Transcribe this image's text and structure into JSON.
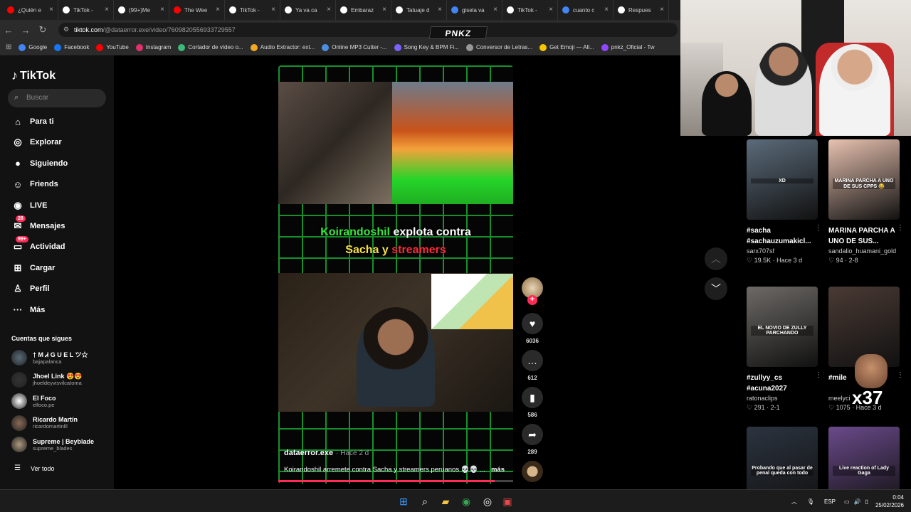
{
  "browser": {
    "tabs": [
      {
        "title": "¿Quién e",
        "icon": "youtube-icon",
        "color": "#ff0000"
      },
      {
        "title": "TikTok -",
        "icon": "tiktok-icon",
        "color": "#ffffff"
      },
      {
        "title": "(99+)Me",
        "icon": "tiktok-icon",
        "color": "#ffffff"
      },
      {
        "title": "The Wee",
        "icon": "youtube-icon",
        "color": "#ff0000"
      },
      {
        "title": "TikTok -",
        "icon": "tiktok-icon",
        "color": "#ffffff"
      },
      {
        "title": "Ya va ca",
        "icon": "tiktok-icon",
        "color": "#ffffff"
      },
      {
        "title": "Embaraz",
        "icon": "tiktok-icon",
        "color": "#ffffff"
      },
      {
        "title": "Tatuaje d",
        "icon": "tiktok-icon",
        "color": "#ffffff"
      },
      {
        "title": "gisela va",
        "icon": "google-icon",
        "color": "#4285f4"
      },
      {
        "title": "TikTok -",
        "icon": "tiktok-icon",
        "color": "#ffffff"
      },
      {
        "title": "cuanto c",
        "icon": "google-icon",
        "color": "#4285f4"
      },
      {
        "title": "Respues",
        "icon": "tiktok-icon",
        "color": "#ffffff"
      }
    ],
    "url_host": "tiktok.com",
    "url_path": "/@dataerror.exe/video/7609820556933729557",
    "overlay_logo": "PNKZ",
    "bookmarks": [
      {
        "label": "Google",
        "color": "#4285f4"
      },
      {
        "label": "Facebook",
        "color": "#1877f2"
      },
      {
        "label": "YouTube",
        "color": "#ff0000"
      },
      {
        "label": "Instagram",
        "color": "#e1306c"
      },
      {
        "label": "Cortador de vídeo o...",
        "color": "#3cb878"
      },
      {
        "label": "Audio Extractor: ext...",
        "color": "#f5a623"
      },
      {
        "label": "Online MP3 Cutter -...",
        "color": "#4a90e2"
      },
      {
        "label": "Song Key & BPM Fi...",
        "color": "#7b61ff"
      },
      {
        "label": "Conversor de Letras...",
        "color": "#999999"
      },
      {
        "label": "Get Emoji — All...",
        "color": "#f7c600"
      },
      {
        "label": "pnkz_Oficial - Tw",
        "color": "#9146ff"
      }
    ]
  },
  "sidebar": {
    "logo": "TikTok",
    "search_placeholder": "Buscar",
    "nav": [
      {
        "label": "Para ti",
        "icon": "home-icon",
        "glyph": "⌂"
      },
      {
        "label": "Explorar",
        "icon": "compass-icon",
        "glyph": "◎"
      },
      {
        "label": "Siguiendo",
        "icon": "following-avatar-icon",
        "glyph": "●"
      },
      {
        "label": "Friends",
        "icon": "friends-icon",
        "glyph": "☺"
      },
      {
        "label": "LIVE",
        "icon": "live-icon",
        "glyph": "◉"
      },
      {
        "label": "Mensajes",
        "icon": "messages-icon",
        "glyph": "✉",
        "badge": "28"
      },
      {
        "label": "Actividad",
        "icon": "activity-icon",
        "glyph": "▭",
        "badge": "99+"
      },
      {
        "label": "Cargar",
        "icon": "upload-icon",
        "glyph": "⊞"
      },
      {
        "label": "Perfil",
        "icon": "profile-icon",
        "glyph": "♙"
      },
      {
        "label": "Más",
        "icon": "more-icon",
        "glyph": "···"
      }
    ],
    "following_title": "Cuentas que sigues",
    "accounts": [
      {
        "name": "† M Ꮧ G U E L ツ☆",
        "handle": "bajapalanca",
        "color": "#5a6b7a"
      },
      {
        "name": "Jhoel Link 😍😍",
        "handle": "jhoeldeyvisvilcatoma",
        "color": "#333333"
      },
      {
        "name": "El Foco",
        "handle": "elfoco.pe",
        "color": "#ffffff"
      },
      {
        "name": "Ricardo Martín",
        "handle": "ricardomartinlll",
        "color": "#8a6a55"
      },
      {
        "name": "Supreme | Beyblade",
        "handle": "supreme_blades",
        "color": "#b09a80"
      }
    ],
    "see_all": "Ver todo"
  },
  "video": {
    "headline_line1_a": "Koirandoshil",
    "headline_line1_b": "explota contra",
    "headline_line2_a": "Sacha",
    "headline_line2_b": "y",
    "headline_line2_c": "streamers",
    "author": "dataerror.exe",
    "posted": "· Hace 2 d",
    "caption": "Koirandoshil arremete contra Sacha y streamers peruanos 💀💀 ...",
    "more": "más",
    "progress": 0.92,
    "likes": "6036",
    "comments": "612",
    "saves": "586",
    "shares": "289"
  },
  "recommendations": [
    {
      "title": "#sacha #sachauzumakicl...",
      "user": "sarx707sf",
      "likes": "19.5K",
      "time": "Hace 3 d",
      "thumb": "#5b6b7a",
      "overlay": "XD"
    },
    {
      "title": "MARINA PARCHA A UNO DE SUS...",
      "user": "sandalio_huamani_gold",
      "likes": "94",
      "time": "2-8",
      "thumb": "#e8c2b0",
      "overlay": "MARINA PARCHA A UNO DE SUS CPPS 😂"
    },
    {
      "title": "#zullyy_cs #acuna2027",
      "user": "ratonaclips",
      "likes": "291",
      "time": "2-1",
      "thumb": "#6d6a66",
      "overlay": "EL NOVIO DE ZULLY PARCHANDO"
    },
    {
      "title": "#mile",
      "user": "meelyci",
      "likes": "1075",
      "time": "Hace 3 d",
      "thumb": "#4a3a34",
      "overlay": ""
    },
    {
      "title": "",
      "user": "",
      "likes": "",
      "time": "",
      "thumb": "#2c3440",
      "overlay": "Probando que al pasar de penal queda con todo"
    },
    {
      "title": "",
      "user": "",
      "likes": "",
      "time": "",
      "thumb": "#6a4a8a",
      "overlay": "Live reaction of Lady Gaga"
    }
  ],
  "x37_sticker": "x37",
  "taskbar": {
    "lang": "ESP",
    "time": "0:04",
    "date": "25/02/2026"
  }
}
